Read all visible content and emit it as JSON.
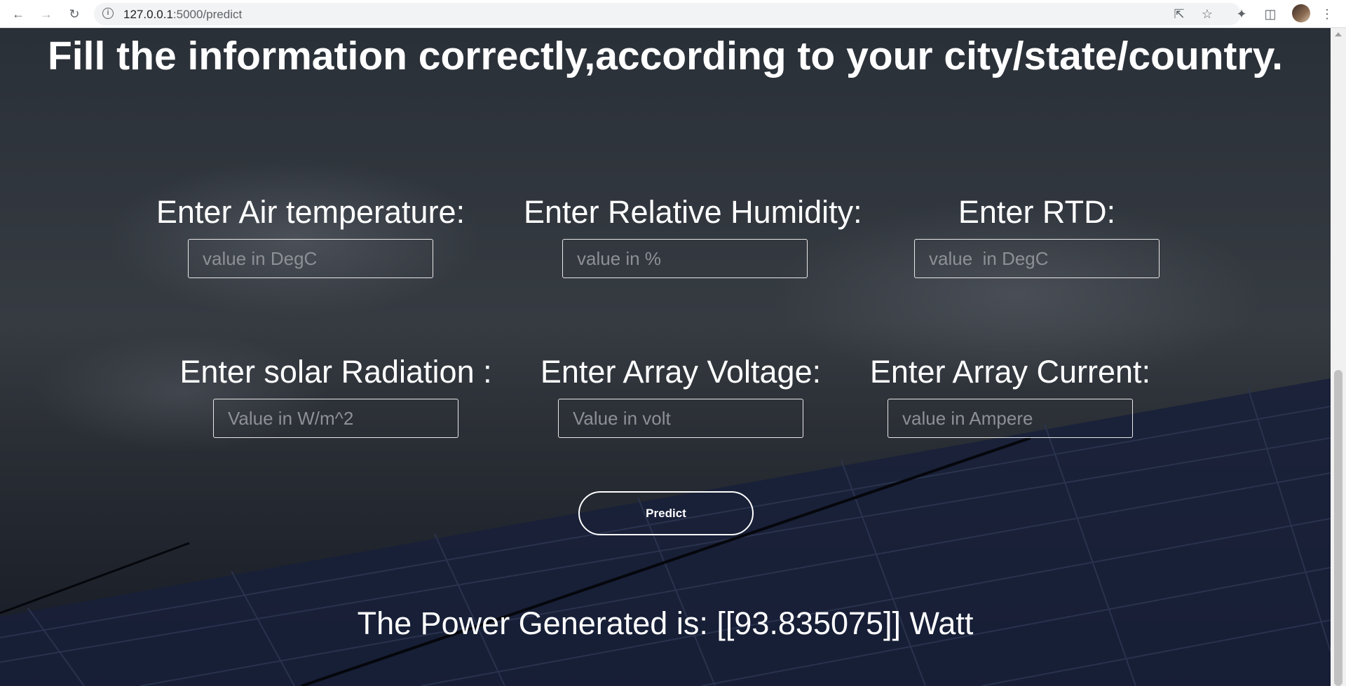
{
  "browser": {
    "url_host": "127.0.0.1",
    "url_path": ":5000/predict"
  },
  "page": {
    "heading": "Fill the information correctly,according to your city/state/country.",
    "fields": [
      {
        "label": "Enter Air temperature:",
        "placeholder": "value in DegC"
      },
      {
        "label": "Enter Relative Humidity:",
        "placeholder": "value in %"
      },
      {
        "label": "Enter RTD:",
        "placeholder": "value  in DegC"
      },
      {
        "label": "Enter solar Radiation :",
        "placeholder": "Value in W/m^2"
      },
      {
        "label": "Enter Array Voltage:",
        "placeholder": "Value in volt"
      },
      {
        "label": "Enter Array Current:",
        "placeholder": "value in Ampere"
      }
    ],
    "predict_label": "Predict",
    "result_text": "The Power Generated is: [[93.835075]] Watt"
  }
}
